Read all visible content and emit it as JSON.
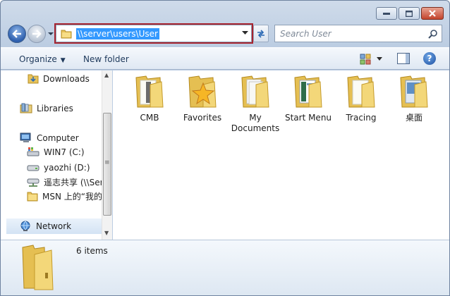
{
  "address": {
    "path": "\\\\server\\users\\User"
  },
  "search": {
    "placeholder": "Search User"
  },
  "toolbar": {
    "organize": "Organize",
    "new_folder": "New folder",
    "help": "?"
  },
  "nav": {
    "downloads": "Downloads",
    "libraries": "Libraries",
    "computer": "Computer",
    "win7": "WIN7 (C:)",
    "yaozhi": "yaozhi (D:)",
    "share": "遥志共享 (\\\\Ser",
    "msn": "MSN 上的“我的",
    "network": "Network"
  },
  "files": [
    {
      "name": "CMB",
      "icon": "folder-icon"
    },
    {
      "name": "Favorites",
      "icon": "favorites-folder-icon"
    },
    {
      "name": "My Documents",
      "icon": "documents-folder-icon"
    },
    {
      "name": "Start Menu",
      "icon": "start-menu-folder-icon"
    },
    {
      "name": "Tracing",
      "icon": "folder-icon"
    },
    {
      "name": "桌面",
      "icon": "desktop-folder-icon"
    }
  ],
  "details": {
    "count": "6 items"
  },
  "colors": {
    "highlight": "#3399ff",
    "address_outline": "#a7232e",
    "folder": "#f2d072"
  }
}
